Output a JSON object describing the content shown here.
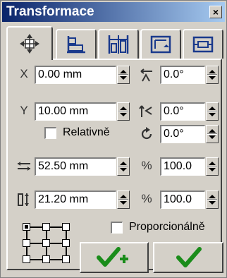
{
  "window": {
    "title": "Transformace",
    "close_glyph": "×"
  },
  "tabs": [
    {
      "icon": "move-icon",
      "active": true
    },
    {
      "icon": "align-icon"
    },
    {
      "icon": "distribute-icon"
    },
    {
      "icon": "size-icon"
    },
    {
      "icon": "frame-icon"
    }
  ],
  "fields": {
    "x": "0.00 mm",
    "y": "10.00 mm",
    "skew_h": "0.0°",
    "skew_v": "0.0°",
    "rotate": "0.0°",
    "width": "52.50 mm",
    "height": "21.20 mm",
    "scale_w": "100.0",
    "scale_h": "100.0"
  },
  "labels": {
    "x": "X",
    "y": "Y",
    "percent_w": "%",
    "percent_h": "%",
    "relative": "Relativně",
    "proportional": "Proporcionálně"
  },
  "checkboxes": {
    "relative": false,
    "proportional": false
  },
  "colors": {
    "accent_green": "#1a8c1a",
    "title_start": "#0a246a",
    "title_end": "#a6caf0"
  }
}
